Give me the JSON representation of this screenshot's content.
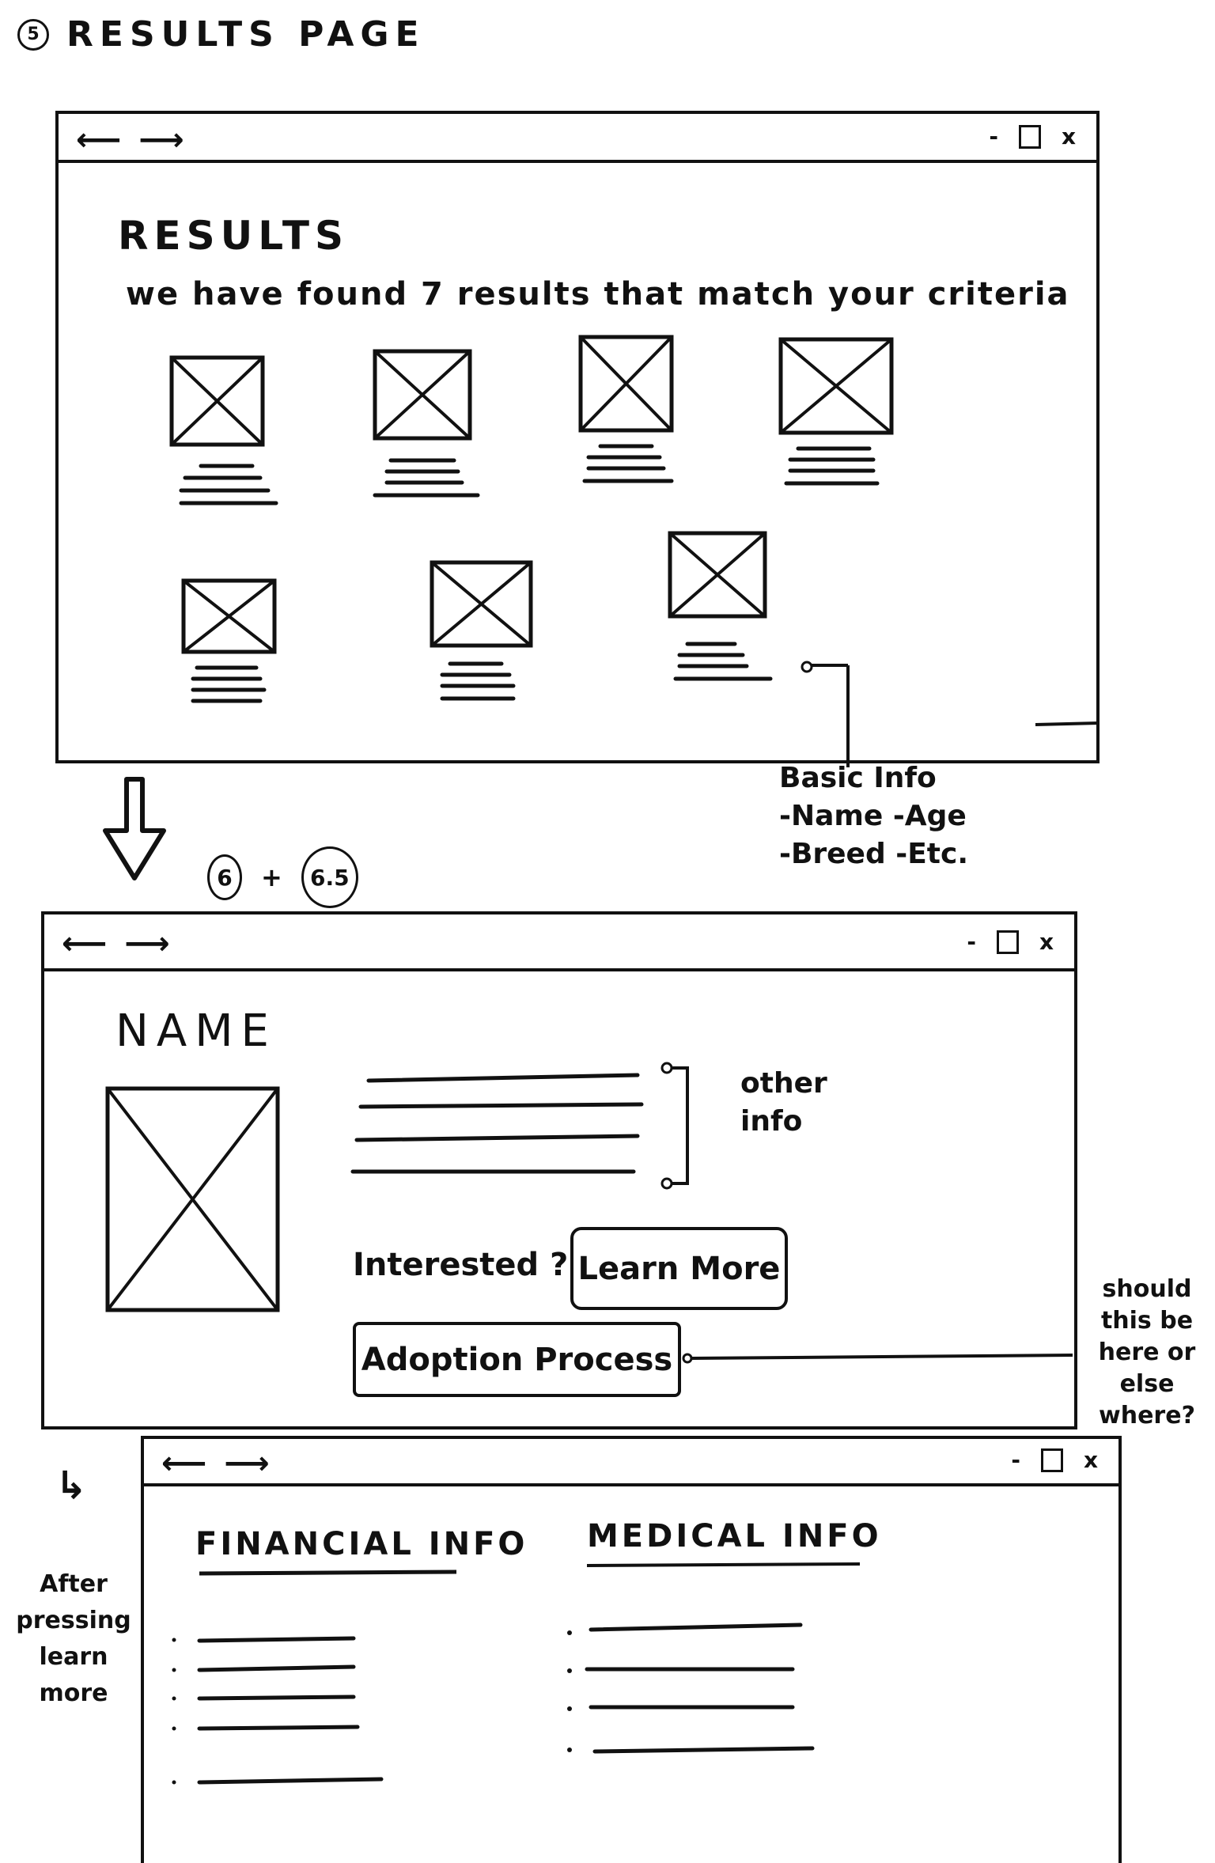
{
  "header": {
    "number": "5",
    "title": "RESULTS PAGE"
  },
  "window_controls": {
    "back_forward": "⟵ ⟶",
    "minimize": "-",
    "close": "x"
  },
  "results_window": {
    "title": "RESULTS",
    "subtitle": "we have found 7 results that match your criteria",
    "note": {
      "title": "Basic Info",
      "line1": "-Name  -Age",
      "line2": "-Breed  -Etc."
    }
  },
  "transition": {
    "a": "6",
    "plus": "+",
    "b": "6.5"
  },
  "detail_window": {
    "name_heading": "NAME",
    "other_info": "other info",
    "interested_label": "Interested ?",
    "learn_more": "Learn More",
    "adoption_process": "Adoption Process",
    "side_note": "should this be here or else where?"
  },
  "learn_window": {
    "arrow": "↳",
    "side_note": "After pressing learn more",
    "financial_title": "FINANCIAL INFO",
    "medical_title": "MEDICAL INFO"
  }
}
